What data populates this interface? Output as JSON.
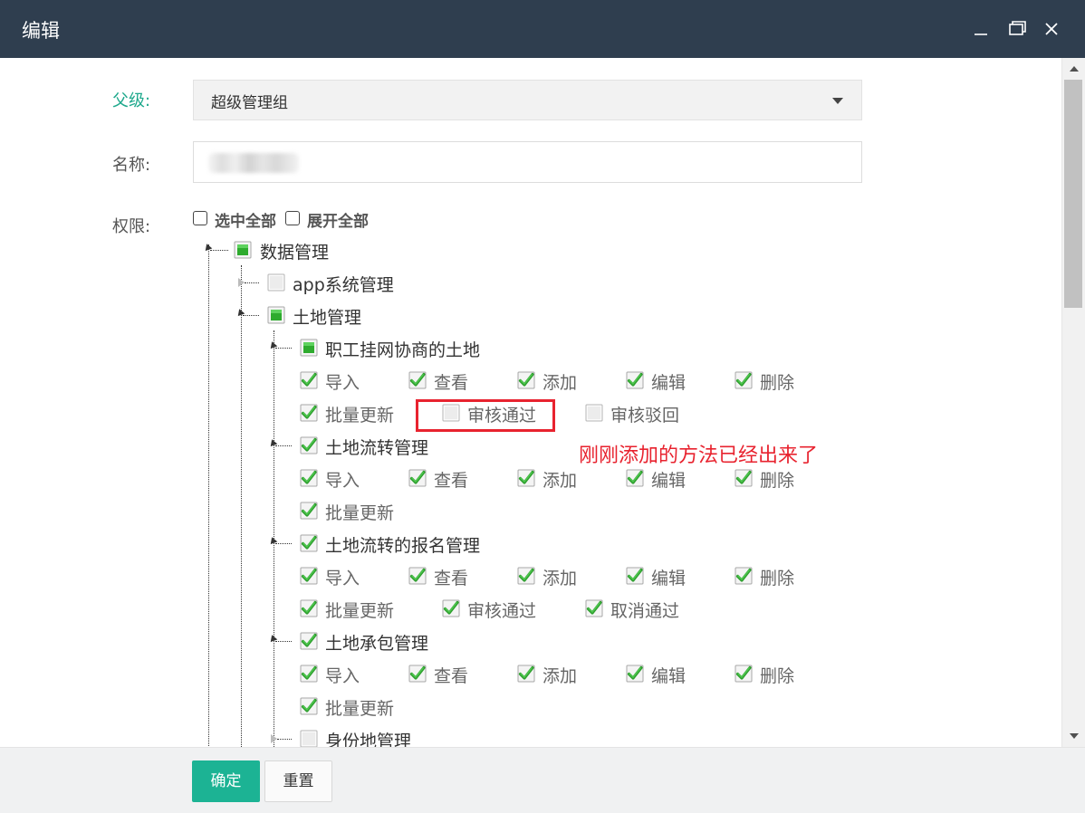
{
  "window": {
    "title": "编辑"
  },
  "form": {
    "parent_label": "父级:",
    "parent_value": "超级管理组",
    "name_label": "名称:",
    "name_value": "",
    "perm_label": "权限:",
    "select_all_label": "选中全部",
    "expand_all_label": "展开全部"
  },
  "tree": {
    "root": {
      "label": "数据管理",
      "state": "partial"
    },
    "app": {
      "label": "app系统管理",
      "state": "unchecked"
    },
    "land": {
      "label": "土地管理",
      "state": "partial"
    },
    "node1": {
      "label": "职工挂网协商的土地",
      "state": "partial"
    },
    "node2": {
      "label": "土地流转管理",
      "state": "checked"
    },
    "node3": {
      "label": "土地流转的报名管理",
      "state": "checked"
    },
    "node4": {
      "label": "土地承包管理",
      "state": "checked"
    },
    "node5": {
      "label": "身份地管理",
      "state": "unchecked"
    },
    "perms": {
      "import": "导入",
      "view": "查看",
      "add": "添加",
      "edit": "编辑",
      "delete": "删除",
      "batch": "批量更新",
      "approve": "审核通过",
      "reject": "审核驳回",
      "cancel_approve": "取消通过"
    }
  },
  "annotation": {
    "text": "刚刚添加的方法已经出来了",
    "color": "#e8232f"
  },
  "footer": {
    "confirm_label": "确定",
    "reset_label": "重置"
  },
  "colors": {
    "header": "#2f3e4f",
    "accent": "#1cb394",
    "label_accent": "#20a98d"
  }
}
